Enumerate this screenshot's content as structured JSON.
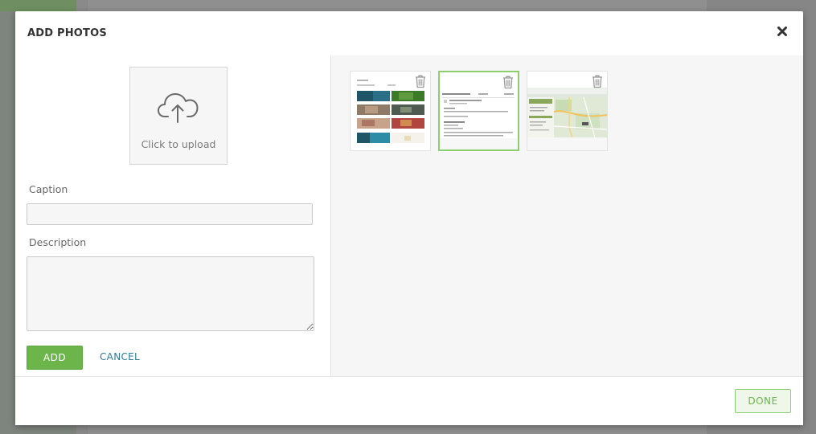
{
  "modal": {
    "title": "ADD PHOTOS",
    "close_icon": "close-icon"
  },
  "upload": {
    "label": "Click to upload",
    "icon": "cloud-upload-icon"
  },
  "form": {
    "caption_label": "Caption",
    "caption_value": "",
    "description_label": "Description",
    "description_value": "",
    "add_label": "ADD",
    "cancel_label": "CANCEL"
  },
  "thumbnails": [
    {
      "kind": "photo-grid",
      "selected": false,
      "icon": "trash-icon"
    },
    {
      "kind": "document",
      "selected": true,
      "icon": "trash-icon"
    },
    {
      "kind": "map",
      "selected": false,
      "icon": "trash-icon"
    }
  ],
  "footer": {
    "done_label": "DONE"
  },
  "colors": {
    "accent": "#6bb54a",
    "link": "#2b7a9a",
    "selected_border": "#8ccf6f"
  }
}
